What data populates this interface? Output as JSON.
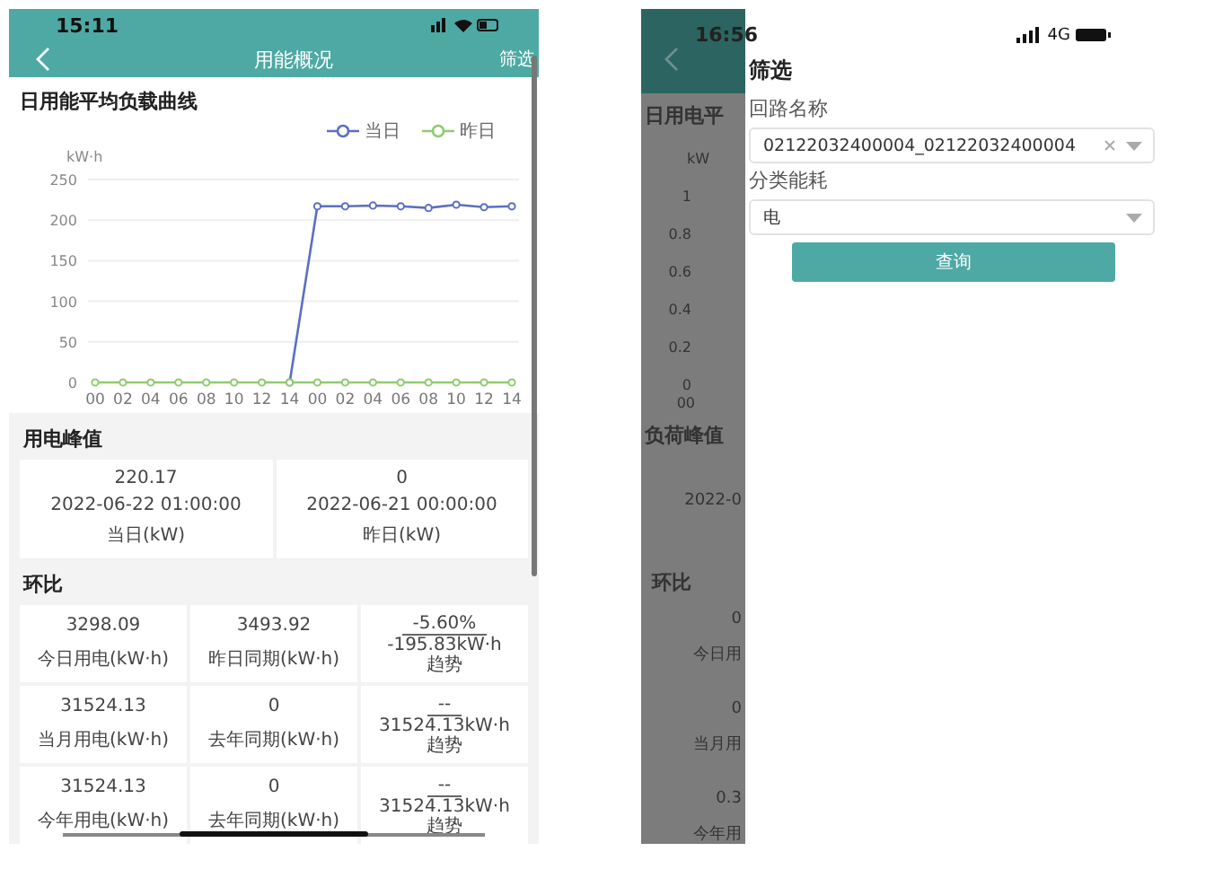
{
  "left_screen": {
    "status_bar": {
      "time": "15:11"
    },
    "nav_bar": {
      "title": "用能概况",
      "action": "筛选"
    },
    "chart_section": {
      "title": "日用能平均负载曲线",
      "chart_data": {
        "type": "line",
        "ylabel": "kW·h",
        "categories": [
          "00",
          "02",
          "04",
          "06",
          "08",
          "10",
          "12",
          "14",
          "00",
          "02",
          "04",
          "06",
          "08",
          "10",
          "12",
          "14"
        ],
        "ylim": [
          0,
          250
        ],
        "yticks": [
          0,
          50,
          100,
          150,
          200,
          250
        ],
        "grid": true,
        "series": [
          {
            "name": "当日",
            "color": "#5b6fc2",
            "marker": "circle",
            "values": [
              null,
              null,
              null,
              null,
              null,
              null,
              null,
              0,
              217,
              217,
              218,
              217,
              215,
              219,
              216,
              217
            ]
          },
          {
            "name": "昨日",
            "color": "#8fcb6f",
            "marker": "circle",
            "values": [
              0,
              0,
              0,
              0,
              0,
              0,
              0,
              0,
              0,
              0,
              0,
              0,
              0,
              0,
              0,
              0
            ]
          }
        ]
      }
    },
    "peak": {
      "title": "用电峰值",
      "cells": [
        {
          "value": "220.17",
          "time": "2022-06-22 01:00:00",
          "label": "当日(kW)"
        },
        {
          "value": "0",
          "time": "2022-06-21 00:00:00",
          "label": "昨日(kW)"
        }
      ]
    },
    "ratio": {
      "title": "环比",
      "rows": [
        {
          "cells": [
            {
              "value": "3298.09",
              "label": "今日用电(kW·h)"
            },
            {
              "value": "3493.92",
              "label": "昨日同期(kW·h)"
            }
          ],
          "trend": {
            "percent": "-5.60%",
            "difference": "-195.83kW·h",
            "label": "趋势"
          }
        },
        {
          "cells": [
            {
              "value": "31524.13",
              "label": "当月用电(kW·h)"
            },
            {
              "value": "0",
              "label": "去年同期(kW·h)"
            }
          ],
          "trend": {
            "percent": "--",
            "difference": "31524.13kW·h",
            "label": "趋势"
          }
        },
        {
          "cells": [
            {
              "value": "31524.13",
              "label": "今年用电(kW·h)"
            },
            {
              "value": "0",
              "label": "去年同期(kW·h)"
            }
          ],
          "trend": {
            "percent": "--",
            "difference": "31524.13kW·h",
            "label": "趋势"
          }
        }
      ]
    }
  },
  "right_screen": {
    "status_bar": {
      "time": "16:56",
      "network": "4G"
    },
    "background_page": {
      "texts": [
        "日用电平",
        "kW",
        "1",
        "0.8",
        "0.6",
        "0.4",
        "0.2",
        "0",
        "00",
        "负荷峰值",
        "2022-0",
        "环比",
        "0",
        "今日用",
        "0",
        "当月用",
        "0.3",
        "今年用"
      ]
    },
    "filter_panel": {
      "title": "筛选",
      "fields": [
        {
          "label": "回路名称",
          "value": "02122032400004_02122032400004",
          "clearable": true
        },
        {
          "label": "分类能耗",
          "value": "电",
          "clearable": false
        }
      ],
      "button": "查询"
    }
  }
}
